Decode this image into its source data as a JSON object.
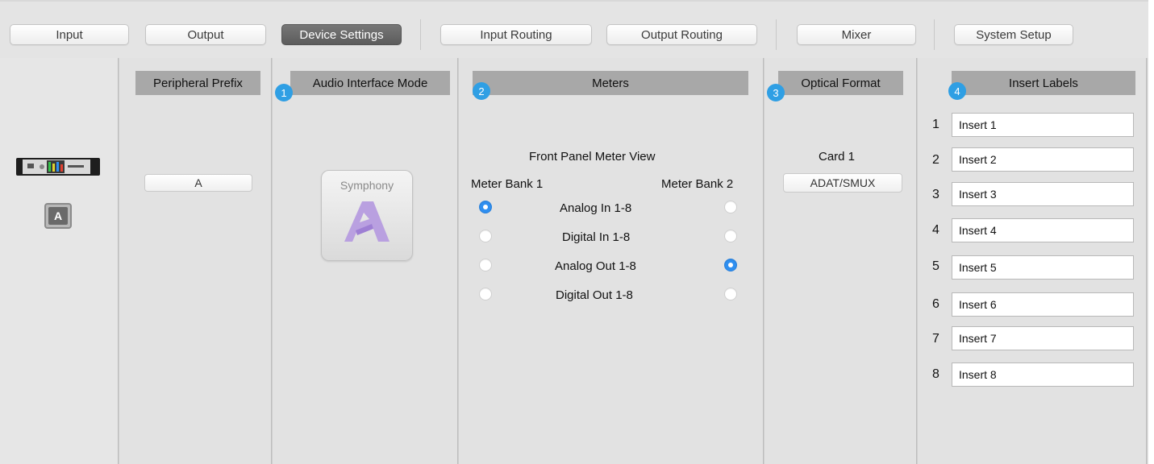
{
  "tabs": [
    {
      "label": "Input",
      "active": false
    },
    {
      "label": "Output",
      "active": false
    },
    {
      "label": "Device Settings",
      "active": true
    },
    {
      "label": "Input Routing",
      "active": false
    },
    {
      "label": "Output Routing",
      "active": false
    },
    {
      "label": "Mixer",
      "active": false
    },
    {
      "label": "System Setup",
      "active": false
    }
  ],
  "device": {
    "icon": "rack-device-icon",
    "selector_label": "A"
  },
  "peripheral": {
    "title": "Peripheral Prefix",
    "value": "A"
  },
  "interface_mode": {
    "badge": "1",
    "title": "Audio Interface Mode",
    "logo_text": "Symphony",
    "logo_icon": "apogee-logo-icon"
  },
  "meters": {
    "badge": "2",
    "title": "Meters",
    "subtitle": "Front Panel Meter View",
    "bank1_label": "Meter Bank 1",
    "bank2_label": "Meter Bank 2",
    "rows": [
      {
        "label": "Analog In 1-8",
        "bank1": true,
        "bank2": false
      },
      {
        "label": "Digital In 1-8",
        "bank1": false,
        "bank2": false
      },
      {
        "label": "Analog Out 1-8",
        "bank1": false,
        "bank2": true
      },
      {
        "label": "Digital Out 1-8",
        "bank1": false,
        "bank2": false
      }
    ]
  },
  "optical": {
    "badge": "3",
    "title": "Optical Format",
    "card_label": "Card 1",
    "value": "ADAT/SMUX"
  },
  "inserts": {
    "badge": "4",
    "title": "Insert Labels",
    "items": [
      {
        "num": "1",
        "value": "Insert 1"
      },
      {
        "num": "2",
        "value": "Insert 2"
      },
      {
        "num": "3",
        "value": "Insert 3"
      },
      {
        "num": "4",
        "value": "Insert 4"
      },
      {
        "num": "5",
        "value": "Insert 5"
      },
      {
        "num": "6",
        "value": "Insert 6"
      },
      {
        "num": "7",
        "value": "Insert 7"
      },
      {
        "num": "8",
        "value": "Insert 8"
      }
    ]
  },
  "colors": {
    "accent": "#2f9fe4",
    "header_bg": "#a8a8a8",
    "active_tab": "#666666",
    "radio_on": "#2f8ff0"
  }
}
